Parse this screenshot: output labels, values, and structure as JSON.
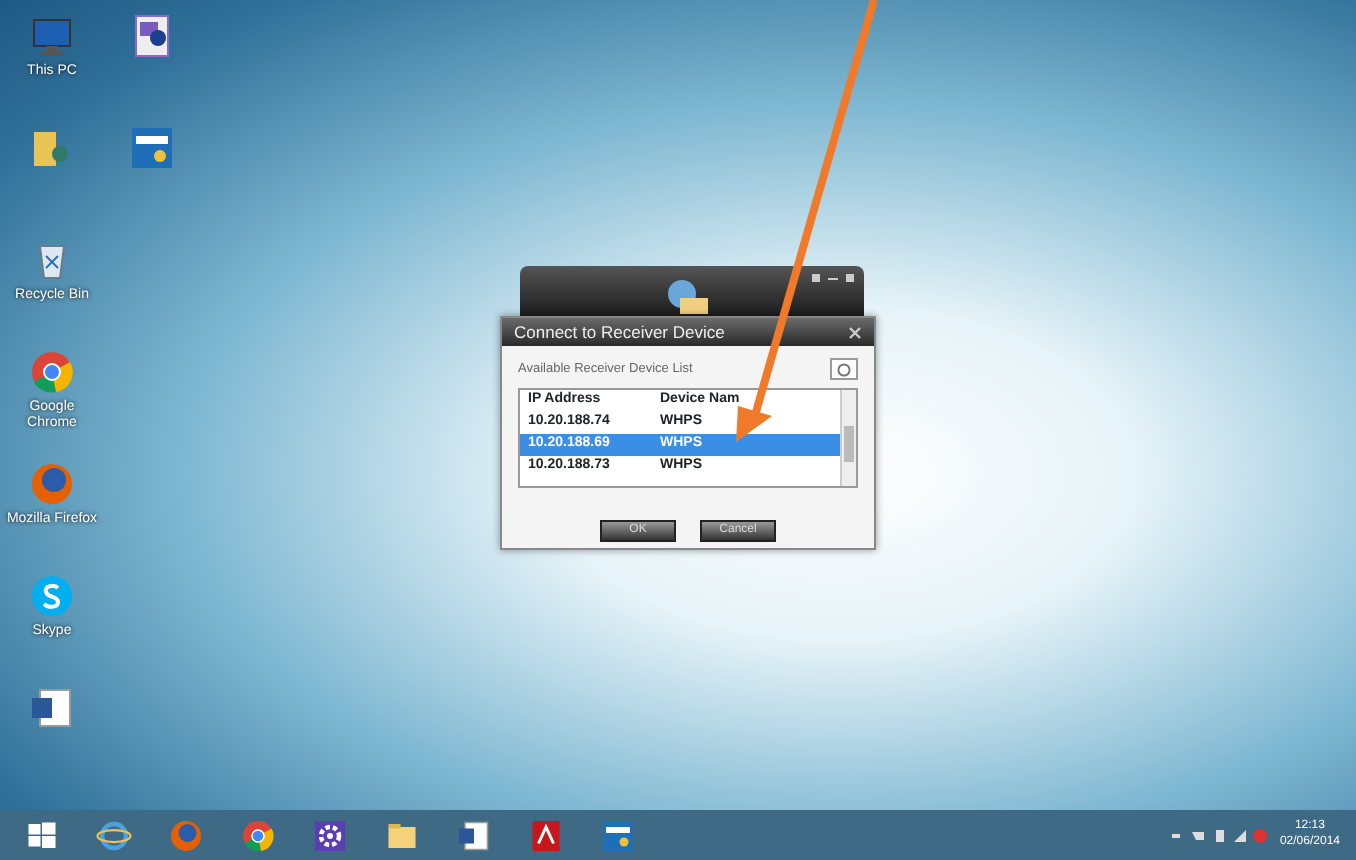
{
  "desktop_icons": [
    {
      "kind": "monitor",
      "label": "This PC"
    },
    {
      "kind": "app"
    },
    {
      "kind": "folder"
    },
    {
      "kind": "whps"
    },
    {
      "kind": "recycle",
      "label": "Recycle Bin"
    },
    {
      "kind": "chrome",
      "label": "Google Chrome"
    },
    {
      "kind": "firefox",
      "label": "Mozilla Firefox"
    },
    {
      "kind": "skype",
      "label": "Skype"
    },
    {
      "kind": "word"
    }
  ],
  "dialog": {
    "title": "Connect to Receiver Device",
    "list_label": "Available Receiver Device List",
    "columns": [
      "IP Address",
      "Device Nam"
    ],
    "rows": [
      {
        "ip": "10.20.188.74",
        "name": "WHPS",
        "selected": false
      },
      {
        "ip": "10.20.188.69",
        "name": "WHPS",
        "selected": true
      },
      {
        "ip": "10.20.188.73",
        "name": "WHPS",
        "selected": false
      }
    ],
    "buttons": [
      "OK",
      "Cancel"
    ]
  },
  "taskbar": {
    "items": [
      {
        "kind": "start"
      },
      {
        "kind": "ie"
      },
      {
        "kind": "firefox"
      },
      {
        "kind": "chrome"
      },
      {
        "kind": "settings"
      },
      {
        "kind": "explorer"
      },
      {
        "kind": "word"
      },
      {
        "kind": "pdf"
      },
      {
        "kind": "whps"
      }
    ],
    "time": "12:13",
    "date": "02/06/2014"
  }
}
